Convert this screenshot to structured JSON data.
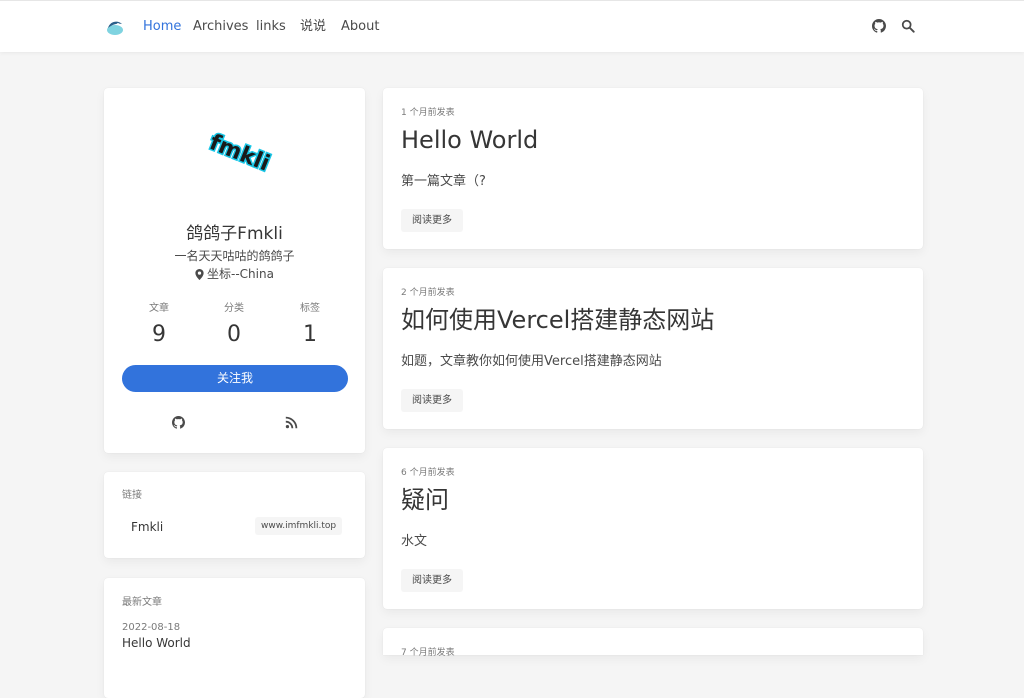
{
  "navbar": {
    "logo_icon": "bird-logo-icon",
    "items": [
      {
        "label": "Home",
        "active": true
      },
      {
        "label": "Archives",
        "active": false
      },
      {
        "label": "links",
        "active": false
      },
      {
        "label": "说说",
        "active": false
      },
      {
        "label": "About",
        "active": false
      }
    ],
    "right_icons": [
      "github-icon",
      "search-icon"
    ],
    "accent_color": "#3273dc"
  },
  "profile": {
    "avatar_text": "fmkli",
    "name": "鸽鸽子Fmkli",
    "description": "一名天天咕咕的鸽鸽子",
    "location": "坐标--China",
    "stats": [
      {
        "label": "文章",
        "value": "9"
      },
      {
        "label": "分类",
        "value": "0"
      },
      {
        "label": "标签",
        "value": "1"
      }
    ],
    "follow_label": "关注我",
    "social_icons": [
      "github-icon",
      "rss-icon"
    ]
  },
  "links_widget": {
    "title": "链接",
    "items": [
      {
        "name": "Fmkli",
        "url": "www.imfmkli.top"
      }
    ]
  },
  "recent_widget": {
    "title": "最新文章",
    "items": [
      {
        "date": "2022-08-18",
        "title": "Hello World"
      }
    ]
  },
  "posts": [
    {
      "meta": "1 个月前发表",
      "title": "Hello World",
      "excerpt": "第一篇文章（?",
      "read_more": "阅读更多"
    },
    {
      "meta": "2 个月前发表",
      "title": "如何使用Vercel搭建静态网站",
      "excerpt": "如题，文章教你如何使用Vercel搭建静态网站",
      "read_more": "阅读更多"
    },
    {
      "meta": "6 个月前发表",
      "title": "疑问",
      "excerpt": "水文",
      "read_more": "阅读更多"
    },
    {
      "meta": "7 个月前发表"
    }
  ]
}
